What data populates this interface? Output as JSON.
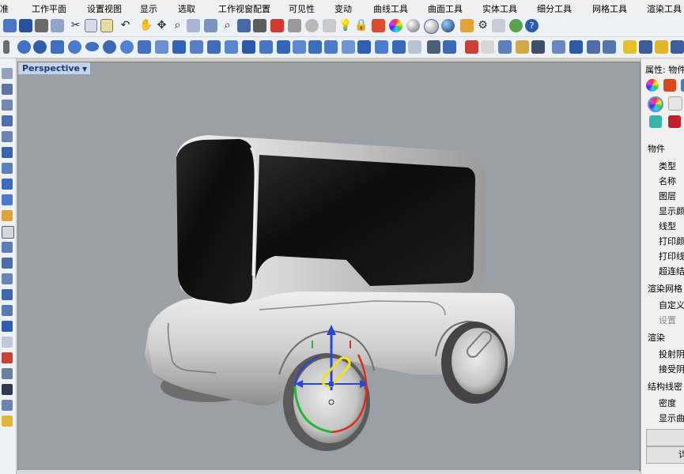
{
  "menu": {
    "items": [
      "准",
      "工作平面",
      "设置视图",
      "显示",
      "选取",
      "工作视窗配置",
      "可见性",
      "变动",
      "曲线工具",
      "曲面工具",
      "实体工具",
      "细分工具",
      "网格工具",
      "渲染工具"
    ]
  },
  "viewport": {
    "label": "Perspective",
    "background": "#9aa0a5"
  },
  "properties": {
    "title": "属性: 物件",
    "sections": [
      {
        "heading": "物件",
        "rows": [
          "类型",
          "名称",
          "图层",
          "显示颜",
          "线型",
          "打印颜",
          "打印线",
          "超连结"
        ]
      },
      {
        "heading": "渲染网格",
        "rows": [
          "自定义",
          "设置"
        ]
      },
      {
        "heading": "渲染",
        "rows": [
          "投射阴",
          "接受阴"
        ]
      },
      {
        "heading": "结构线密",
        "rows": [
          "密度",
          "显示曲"
        ]
      }
    ],
    "button_label": "详"
  },
  "colors": {
    "toolbar_bg": "#eef1f6",
    "viewport_tab": "#c6d3e6",
    "gumball_x": "#e02a1a",
    "gumball_y": "#23b838",
    "gumball_z": "#2747d8",
    "selection": "#f2e21c"
  }
}
